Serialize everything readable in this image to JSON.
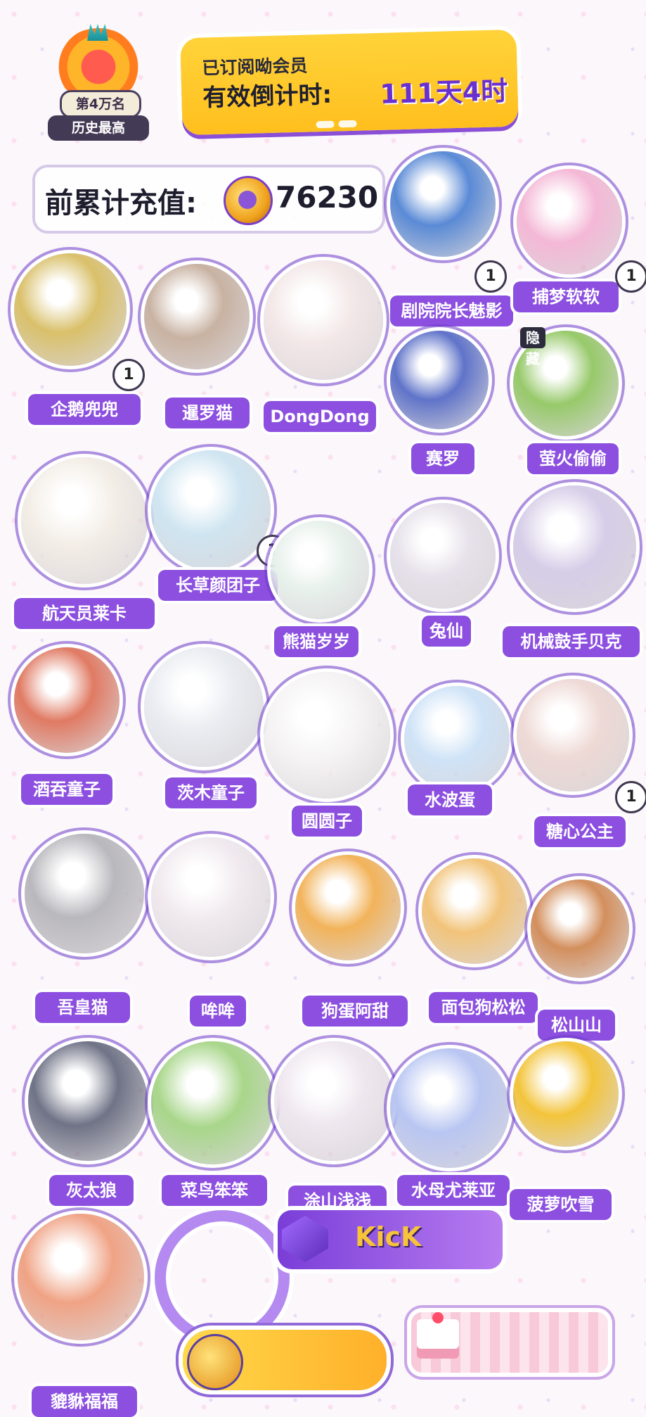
{
  "header": {
    "rank_label": "第4万名",
    "rank_sub": "历史最高",
    "subscription_title": "已订阅呦会员",
    "countdown_label": "有效倒计时:",
    "countdown_value": "111天4时",
    "recharge_label": "前累计充值:",
    "recharge_value": "76230"
  },
  "figures": [
    {
      "name": "剧院院长魅影",
      "count": "1",
      "color": "#5a8ad6"
    },
    {
      "name": "捕梦软软",
      "count": "1",
      "color": "#f4b8d6"
    },
    {
      "name": "企鹅兜兜",
      "count": "1",
      "color": "#d9c06a"
    },
    {
      "name": "暹罗猫",
      "count": "",
      "color": "#c8b2a2"
    },
    {
      "name": "DongDong",
      "count": "",
      "color": "#f3e7e7"
    },
    {
      "name": "赛罗",
      "count": "",
      "color": "#5f73c9"
    },
    {
      "name": "萤火偷偷",
      "count": "",
      "color": "#97c96a",
      "tag": "隐藏"
    },
    {
      "name": "航天员莱卡",
      "count": "",
      "color": "#f3ede6"
    },
    {
      "name": "长草颜团子",
      "count": "1",
      "color": "#cfe5f1"
    },
    {
      "name": "熊猫岁岁",
      "count": "",
      "color": "#e8f1ec"
    },
    {
      "name": "兔仙",
      "count": "",
      "color": "#e6e1ea"
    },
    {
      "name": "机械鼓手贝克",
      "count": "",
      "color": "#d6cde8"
    },
    {
      "name": "酒吞童子",
      "count": "",
      "color": "#e07a63"
    },
    {
      "name": "茨木童子",
      "count": "",
      "color": "#e9ecf1"
    },
    {
      "name": "圆圆子",
      "count": "",
      "color": "#f5f3f3"
    },
    {
      "name": "水波蛋",
      "count": "",
      "color": "#cfe3f7"
    },
    {
      "name": "糖心公主",
      "count": "1",
      "color": "#eed9d5"
    },
    {
      "name": "吾皇猫",
      "count": "",
      "color": "#b9b8bd"
    },
    {
      "name": "哞哞",
      "count": "",
      "color": "#f0e9ee"
    },
    {
      "name": "狗蛋阿甜",
      "count": "",
      "color": "#f2b35a"
    },
    {
      "name": "面包狗松松",
      "count": "",
      "color": "#f2c47a"
    },
    {
      "name": "松山山",
      "count": "",
      "color": "#d38f5d"
    },
    {
      "name": "灰太狼",
      "count": "",
      "color": "#6f7386"
    },
    {
      "name": "菜鸟笨笨",
      "count": "",
      "color": "#a8d68a"
    },
    {
      "name": "涂山浅浅",
      "count": "",
      "color": "#efe7ef"
    },
    {
      "name": "水母尤莱亚",
      "count": "",
      "color": "#b9c6f2"
    },
    {
      "name": "菠萝吹雪",
      "count": "",
      "color": "#f3c43b"
    },
    {
      "name": "貔貅福福",
      "count": "",
      "color": "#f0a385"
    }
  ],
  "bottom": {
    "kick_label": "KicK"
  }
}
